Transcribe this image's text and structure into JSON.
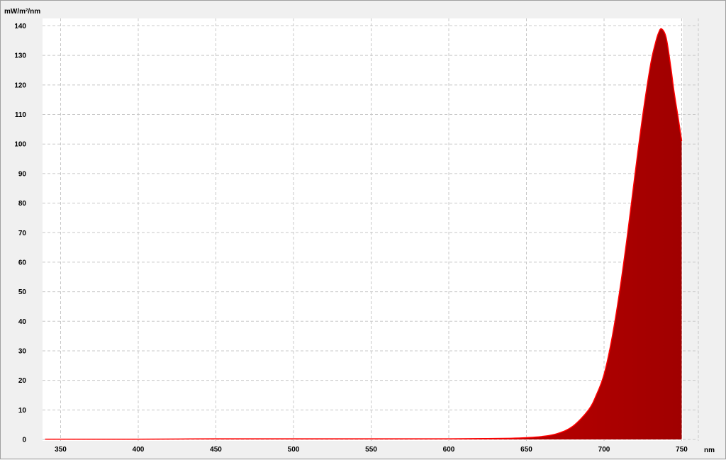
{
  "chart_data": {
    "type": "area",
    "title": "",
    "xlabel": "nm",
    "ylabel": "mW/m²/nm",
    "xlim": [
      340,
      750
    ],
    "ylim": [
      0,
      140
    ],
    "xticks": [
      350,
      400,
      450,
      500,
      550,
      600,
      650,
      700,
      750
    ],
    "yticks": [
      0,
      10,
      20,
      30,
      40,
      50,
      60,
      70,
      80,
      90,
      100,
      110,
      120,
      130,
      140
    ],
    "grid": true,
    "legend": "none",
    "fill_color_start": "#ff0000",
    "fill_color_end": "#a00000",
    "series": [
      {
        "x": [
          340,
          400,
          450,
          500,
          550,
          600,
          625,
          640,
          650,
          660,
          670,
          680,
          690,
          695,
          700,
          705,
          710,
          715,
          720,
          725,
          730,
          733,
          735,
          737,
          740,
          743,
          745,
          748,
          750
        ],
        "values": [
          0.1,
          0.1,
          0.2,
          0.2,
          0.2,
          0.2,
          0.3,
          0.4,
          0.6,
          1.0,
          2.0,
          4.5,
          10.0,
          15.0,
          22.0,
          34.0,
          50.0,
          69.0,
          90.0,
          110.0,
          127.0,
          134.0,
          137.5,
          139.0,
          136.0,
          126.0,
          118.0,
          108.0,
          101.0
        ]
      }
    ]
  }
}
